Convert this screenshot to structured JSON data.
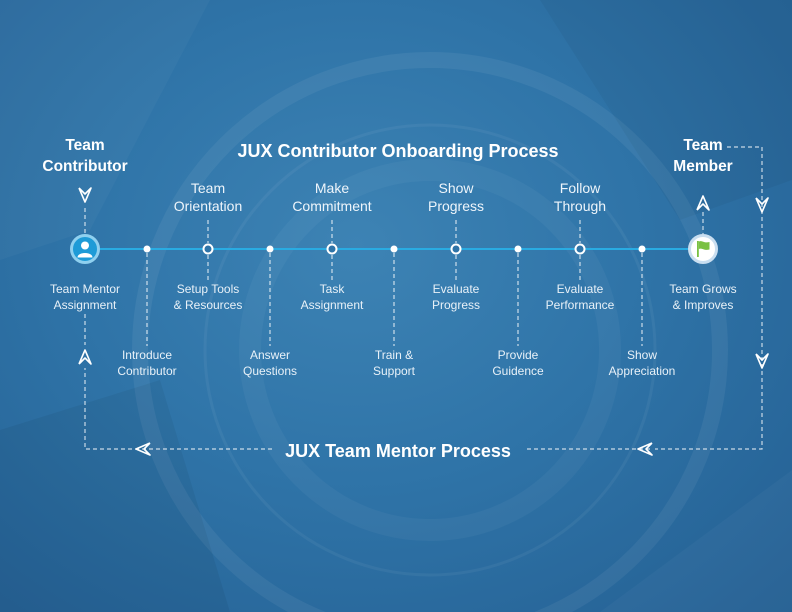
{
  "title": "JUX Contributor Onboarding Process",
  "bottom_title": "JUX Team Mentor Process",
  "start": {
    "label": "Team\nContributor",
    "below": "Team Mentor\nAssignment"
  },
  "end": {
    "label": "Team\nMember",
    "below": "Team Grows\n& Improves"
  },
  "stages": [
    "Team\nOrientation",
    "Make\nCommitment",
    "Show\nProgress",
    "Follow\nThrough"
  ],
  "stage_below": [
    "Setup Tools\n& Resources",
    "Task\nAssignment",
    "Evaluate\nProgress",
    "Evaluate\nPerformance"
  ],
  "steps": [
    "Introduce\nContributor",
    "Answer\nQuestions",
    "Train &\nSupport",
    "Provide\nGuidence",
    "Show\nAppreciation"
  ],
  "icons": {
    "start": "user-icon",
    "end": "flag-icon"
  },
  "colors": {
    "line": "#29abe2",
    "accent": "#1e9bd7",
    "flag": "#7ac143"
  }
}
